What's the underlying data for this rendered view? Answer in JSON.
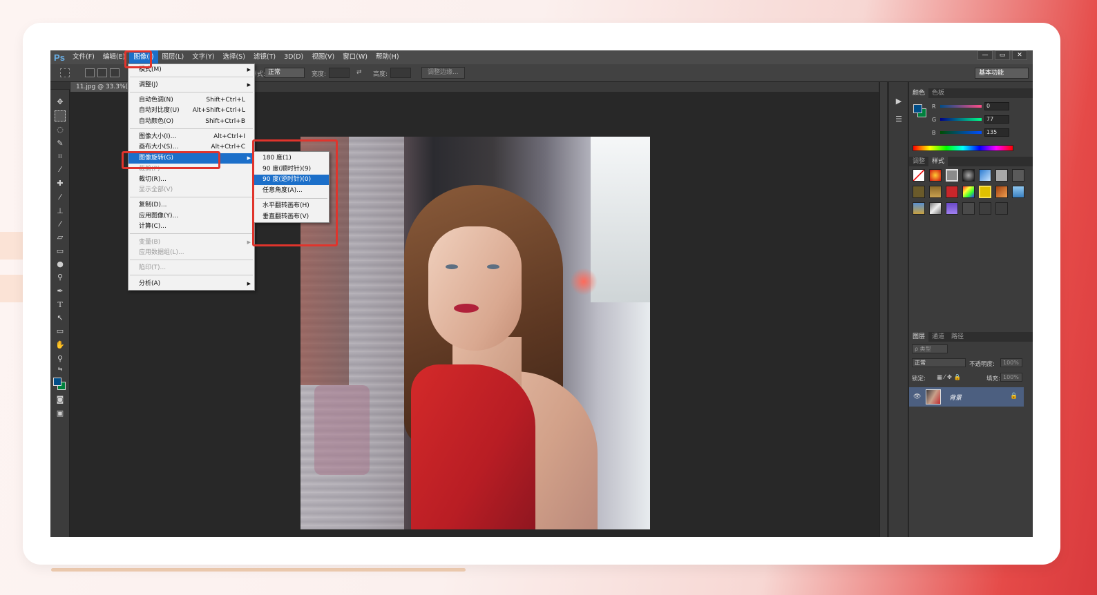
{
  "app": {
    "logo": "Ps",
    "menu": [
      "文件(F)",
      "编辑(E)",
      "图像(I)",
      "图层(L)",
      "文字(Y)",
      "选择(S)",
      "滤镜(T)",
      "3D(D)",
      "视图(V)",
      "窗口(W)",
      "帮助(H)"
    ],
    "active_menu": "图像(I)",
    "window_controls": [
      "—",
      "▭",
      "✕"
    ]
  },
  "options_bar": {
    "style_label": "样式:",
    "style_value": "正常",
    "width_label": "宽度:",
    "height_label": "高度:",
    "refine_button": "调整边缘...",
    "workspace": "基本功能"
  },
  "document": {
    "tab_title": "11.jpg @ 33.3%(RGB/8)"
  },
  "image_menu": {
    "items": [
      {
        "label": "模式(M)",
        "shortcut": "",
        "submenu": true,
        "disabled": false
      },
      {
        "label": "调整(J)",
        "shortcut": "",
        "submenu": true,
        "disabled": false
      },
      {
        "label": "自动色调(N)",
        "shortcut": "Shift+Ctrl+L",
        "submenu": false,
        "disabled": false
      },
      {
        "label": "自动对比度(U)",
        "shortcut": "Alt+Shift+Ctrl+L",
        "submenu": false,
        "disabled": false
      },
      {
        "label": "自动颜色(O)",
        "shortcut": "Shift+Ctrl+B",
        "submenu": false,
        "disabled": false
      },
      {
        "label": "图像大小(I)...",
        "shortcut": "Alt+Ctrl+I",
        "submenu": false,
        "disabled": false
      },
      {
        "label": "画布大小(S)...",
        "shortcut": "Alt+Ctrl+C",
        "submenu": false,
        "disabled": false
      },
      {
        "label": "图像旋转(G)",
        "shortcut": "",
        "submenu": true,
        "disabled": false,
        "highlighted": true
      },
      {
        "label": "裁剪(P)",
        "shortcut": "",
        "submenu": false,
        "disabled": true
      },
      {
        "label": "裁切(R)...",
        "shortcut": "",
        "submenu": false,
        "disabled": false
      },
      {
        "label": "显示全部(V)",
        "shortcut": "",
        "submenu": false,
        "disabled": true
      },
      {
        "label": "复制(D)...",
        "shortcut": "",
        "submenu": false,
        "disabled": false
      },
      {
        "label": "应用图像(Y)...",
        "shortcut": "",
        "submenu": false,
        "disabled": false
      },
      {
        "label": "计算(C)...",
        "shortcut": "",
        "submenu": false,
        "disabled": false
      },
      {
        "label": "变量(B)",
        "shortcut": "",
        "submenu": true,
        "disabled": true
      },
      {
        "label": "应用数据组(L)...",
        "shortcut": "",
        "submenu": false,
        "disabled": true
      },
      {
        "label": "陷印(T)...",
        "shortcut": "",
        "submenu": false,
        "disabled": true
      },
      {
        "label": "分析(A)",
        "shortcut": "",
        "submenu": true,
        "disabled": false
      }
    ]
  },
  "rotate_submenu": {
    "items": [
      {
        "label": "180 度(1)",
        "highlighted": false
      },
      {
        "label": "90 度(顺时针)(9)",
        "highlighted": false
      },
      {
        "label": "90 度(逆时针)(0)",
        "highlighted": true
      },
      {
        "label": "任意角度(A)...",
        "highlighted": false
      },
      {
        "label": "水平翻转画布(H)",
        "highlighted": false
      },
      {
        "label": "垂直翻转画布(V)",
        "highlighted": false
      }
    ]
  },
  "color_panel": {
    "tabs": [
      "颜色",
      "色板"
    ],
    "channels": [
      {
        "label": "R",
        "value": "0"
      },
      {
        "label": "G",
        "value": "77"
      },
      {
        "label": "B",
        "value": "135"
      }
    ],
    "foreground": "#004d87",
    "background": "#00803d"
  },
  "styles_panel": {
    "tabs": [
      "调整",
      "样式"
    ]
  },
  "layers_panel": {
    "tabs": [
      "图层",
      "通道",
      "路径"
    ],
    "filter_label": "ρ 类型",
    "blend_mode": "正常",
    "opacity_label": "不透明度:",
    "opacity_value": "100%",
    "lock_label": "锁定:",
    "fill_label": "填充:",
    "fill_value": "100%",
    "layers": [
      {
        "name": "背景",
        "visible": true,
        "locked": true
      }
    ]
  },
  "colors": {
    "accent": "#1c6fc9",
    "annotation": "#e0342c"
  }
}
